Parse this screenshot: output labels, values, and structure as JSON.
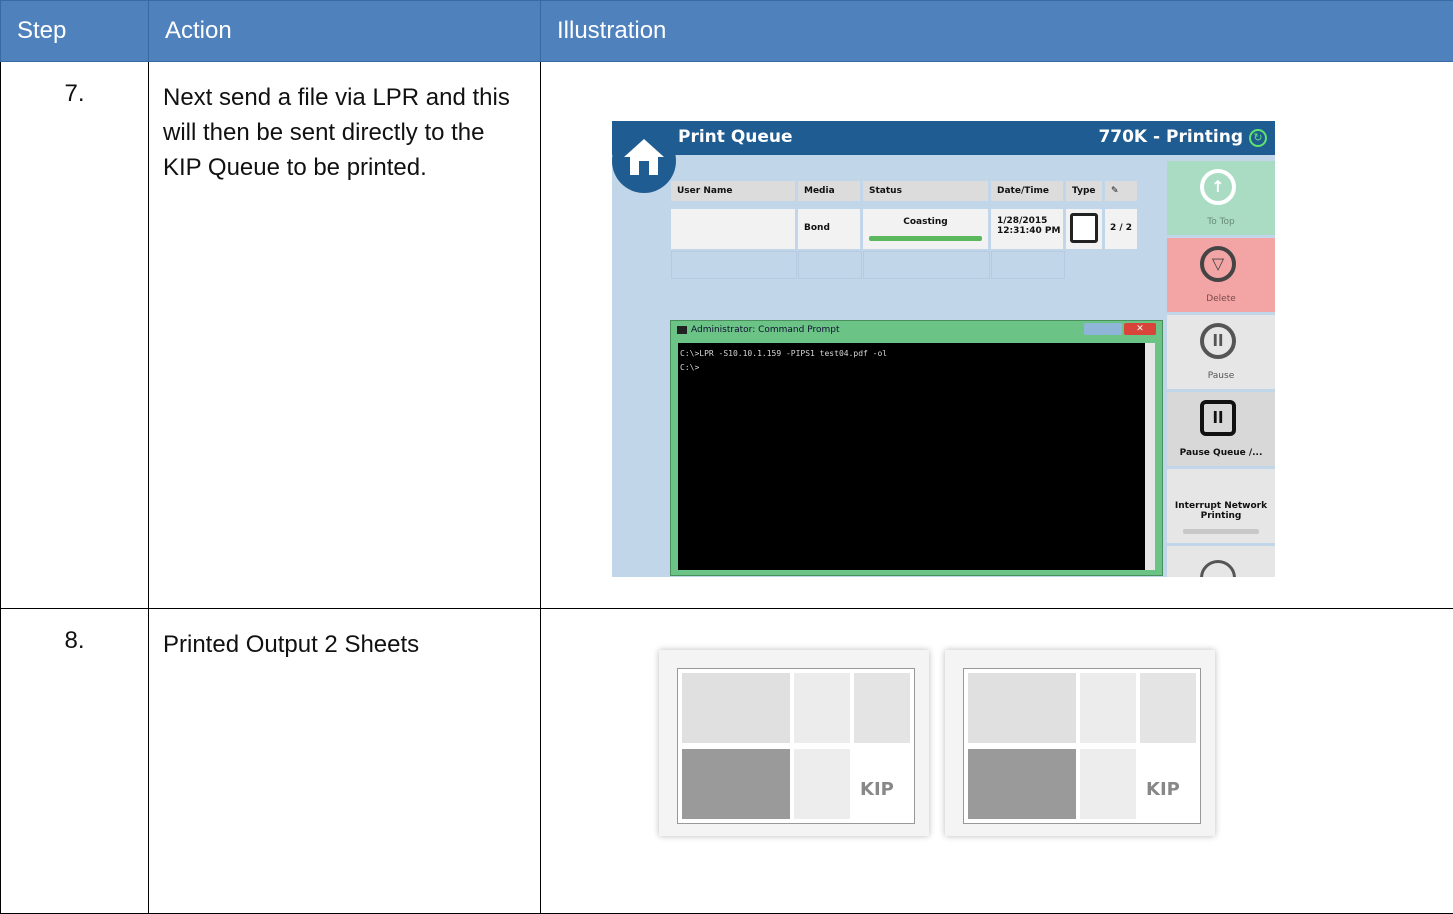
{
  "table": {
    "headers": [
      "Step",
      "Action",
      "Illustration"
    ],
    "rows": [
      {
        "step": "7.",
        "action": "Next send a file via LPR and this will then be sent directly to the KIP Queue to be printed."
      },
      {
        "step": "8.",
        "action": "Printed Output 2 Sheets"
      }
    ]
  },
  "print_queue": {
    "title": "Print Queue",
    "status": "770K - Printing",
    "columns": [
      "User Name",
      "Media",
      "Status",
      "Date/Time",
      "Type",
      ""
    ],
    "job": {
      "media": "Bond",
      "status": "Coasting",
      "date": "1/28/2015",
      "time": "12:31:40 PM",
      "count": "2 / 2",
      "progress": 1.0
    },
    "buttons": {
      "to_top": "To Top",
      "delete": "Delete",
      "pause": "Pause",
      "pause_queue": "Pause Queue /...",
      "interrupt": "Interrupt Network Printing"
    }
  },
  "cmd": {
    "title": "Administrator: Command Prompt",
    "line1": "C:\\>LPR -S10.10.1.159 -PIPS1 test04.pdf -ol",
    "line2": "C:\\>"
  },
  "colors": {
    "header_bg": "#4f81bd",
    "queue_bar": "#1f5c91",
    "to_top": "#a9dcc3",
    "delete": "#f3a5a5",
    "progress": "#5cb85c"
  }
}
